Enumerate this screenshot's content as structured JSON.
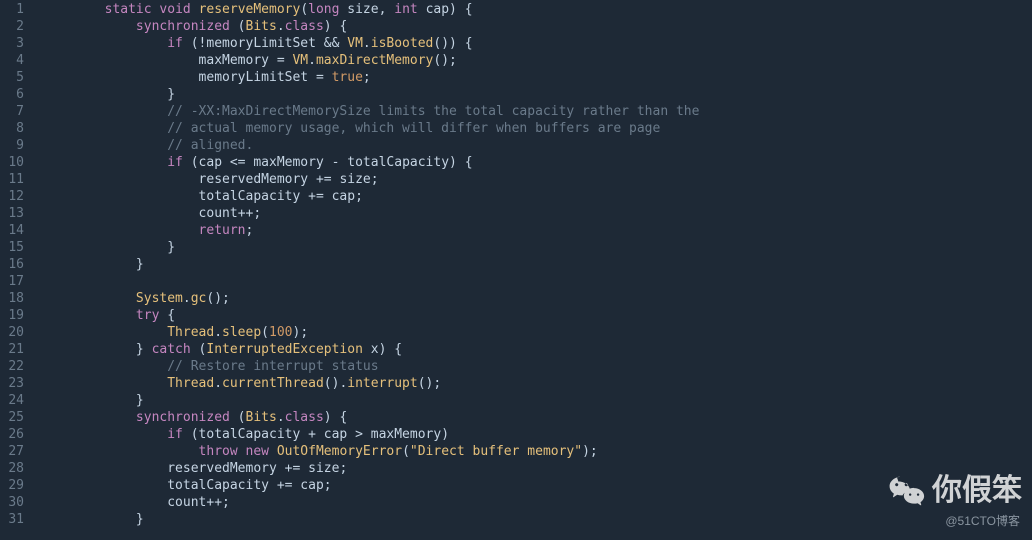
{
  "code": {
    "lines": [
      {
        "num": "1",
        "indent": 2,
        "tokens": [
          [
            "kw",
            "static"
          ],
          [
            "",
            " "
          ],
          [
            "kw",
            "void"
          ],
          [
            "",
            " "
          ],
          [
            "fn",
            "reserveMemory"
          ],
          [
            "pn",
            "("
          ],
          [
            "kw",
            "long"
          ],
          [
            "",
            " "
          ],
          [
            "id",
            "size"
          ],
          [
            "pn",
            ","
          ],
          [
            "",
            " "
          ],
          [
            "kw",
            "int"
          ],
          [
            "",
            " "
          ],
          [
            "id",
            "cap"
          ],
          [
            "pn",
            ")"
          ],
          [
            "",
            " "
          ],
          [
            "pn",
            "{"
          ]
        ]
      },
      {
        "num": "2",
        "indent": 3,
        "tokens": [
          [
            "kw",
            "synchronized"
          ],
          [
            "",
            " "
          ],
          [
            "pn",
            "("
          ],
          [
            "cls",
            "Bits"
          ],
          [
            "pn",
            "."
          ],
          [
            "kw",
            "class"
          ],
          [
            "pn",
            ")"
          ],
          [
            "",
            " "
          ],
          [
            "pn",
            "{"
          ]
        ]
      },
      {
        "num": "3",
        "indent": 4,
        "tokens": [
          [
            "kw",
            "if"
          ],
          [
            "",
            " "
          ],
          [
            "pn",
            "("
          ],
          [
            "op",
            "!"
          ],
          [
            "id",
            "memoryLimitSet"
          ],
          [
            "",
            " "
          ],
          [
            "op",
            "&&"
          ],
          [
            "",
            " "
          ],
          [
            "cls",
            "VM"
          ],
          [
            "pn",
            "."
          ],
          [
            "fn",
            "isBooted"
          ],
          [
            "pn",
            "("
          ],
          [
            "pn",
            ")"
          ],
          [
            "pn",
            ")"
          ],
          [
            "",
            " "
          ],
          [
            "pn",
            "{"
          ]
        ]
      },
      {
        "num": "4",
        "indent": 5,
        "tokens": [
          [
            "id",
            "maxMemory"
          ],
          [
            "",
            " "
          ],
          [
            "op",
            "="
          ],
          [
            "",
            " "
          ],
          [
            "cls",
            "VM"
          ],
          [
            "pn",
            "."
          ],
          [
            "fn",
            "maxDirectMemory"
          ],
          [
            "pn",
            "("
          ],
          [
            "pn",
            ")"
          ],
          [
            "pn",
            ";"
          ]
        ]
      },
      {
        "num": "5",
        "indent": 5,
        "tokens": [
          [
            "id",
            "memoryLimitSet"
          ],
          [
            "",
            " "
          ],
          [
            "op",
            "="
          ],
          [
            "",
            " "
          ],
          [
            "bool",
            "true"
          ],
          [
            "pn",
            ";"
          ]
        ]
      },
      {
        "num": "6",
        "indent": 4,
        "tokens": [
          [
            "pn",
            "}"
          ]
        ]
      },
      {
        "num": "7",
        "indent": 4,
        "tokens": [
          [
            "cmt",
            "// -XX:MaxDirectMemorySize limits the total capacity rather than the"
          ]
        ]
      },
      {
        "num": "8",
        "indent": 4,
        "tokens": [
          [
            "cmt",
            "// actual memory usage, which will differ when buffers are page"
          ]
        ]
      },
      {
        "num": "9",
        "indent": 4,
        "tokens": [
          [
            "cmt",
            "// aligned."
          ]
        ]
      },
      {
        "num": "10",
        "indent": 4,
        "tokens": [
          [
            "kw",
            "if"
          ],
          [
            "",
            " "
          ],
          [
            "pn",
            "("
          ],
          [
            "id",
            "cap"
          ],
          [
            "",
            " "
          ],
          [
            "op",
            "<="
          ],
          [
            "",
            " "
          ],
          [
            "id",
            "maxMemory"
          ],
          [
            "",
            " "
          ],
          [
            "op",
            "-"
          ],
          [
            "",
            " "
          ],
          [
            "id",
            "totalCapacity"
          ],
          [
            "pn",
            ")"
          ],
          [
            "",
            " "
          ],
          [
            "pn",
            "{"
          ]
        ]
      },
      {
        "num": "11",
        "indent": 5,
        "tokens": [
          [
            "id",
            "reservedMemory"
          ],
          [
            "",
            " "
          ],
          [
            "op",
            "+="
          ],
          [
            "",
            " "
          ],
          [
            "id",
            "size"
          ],
          [
            "pn",
            ";"
          ]
        ]
      },
      {
        "num": "12",
        "indent": 5,
        "tokens": [
          [
            "id",
            "totalCapacity"
          ],
          [
            "",
            " "
          ],
          [
            "op",
            "+="
          ],
          [
            "",
            " "
          ],
          [
            "id",
            "cap"
          ],
          [
            "pn",
            ";"
          ]
        ]
      },
      {
        "num": "13",
        "indent": 5,
        "tokens": [
          [
            "id",
            "count"
          ],
          [
            "op",
            "++"
          ],
          [
            "pn",
            ";"
          ]
        ]
      },
      {
        "num": "14",
        "indent": 5,
        "tokens": [
          [
            "kw",
            "return"
          ],
          [
            "pn",
            ";"
          ]
        ]
      },
      {
        "num": "15",
        "indent": 4,
        "tokens": [
          [
            "pn",
            "}"
          ]
        ]
      },
      {
        "num": "16",
        "indent": 3,
        "tokens": [
          [
            "pn",
            "}"
          ]
        ]
      },
      {
        "num": "17",
        "indent": 3,
        "tokens": []
      },
      {
        "num": "18",
        "indent": 3,
        "tokens": [
          [
            "cls",
            "System"
          ],
          [
            "pn",
            "."
          ],
          [
            "fn",
            "gc"
          ],
          [
            "pn",
            "("
          ],
          [
            "pn",
            ")"
          ],
          [
            "pn",
            ";"
          ]
        ]
      },
      {
        "num": "19",
        "indent": 3,
        "tokens": [
          [
            "kw",
            "try"
          ],
          [
            "",
            " "
          ],
          [
            "pn",
            "{"
          ]
        ]
      },
      {
        "num": "20",
        "indent": 4,
        "tokens": [
          [
            "cls",
            "Thread"
          ],
          [
            "pn",
            "."
          ],
          [
            "fn",
            "sleep"
          ],
          [
            "pn",
            "("
          ],
          [
            "num",
            "100"
          ],
          [
            "pn",
            ")"
          ],
          [
            "pn",
            ";"
          ]
        ]
      },
      {
        "num": "21",
        "indent": 3,
        "tokens": [
          [
            "pn",
            "}"
          ],
          [
            "",
            " "
          ],
          [
            "kw",
            "catch"
          ],
          [
            "",
            " "
          ],
          [
            "pn",
            "("
          ],
          [
            "cls",
            "InterruptedException"
          ],
          [
            "",
            " "
          ],
          [
            "id",
            "x"
          ],
          [
            "pn",
            ")"
          ],
          [
            "",
            " "
          ],
          [
            "pn",
            "{"
          ]
        ]
      },
      {
        "num": "22",
        "indent": 4,
        "tokens": [
          [
            "cmt",
            "// Restore interrupt status"
          ]
        ]
      },
      {
        "num": "23",
        "indent": 4,
        "tokens": [
          [
            "cls",
            "Thread"
          ],
          [
            "pn",
            "."
          ],
          [
            "fn",
            "currentThread"
          ],
          [
            "pn",
            "("
          ],
          [
            "pn",
            ")"
          ],
          [
            "pn",
            "."
          ],
          [
            "fn",
            "interrupt"
          ],
          [
            "pn",
            "("
          ],
          [
            "pn",
            ")"
          ],
          [
            "pn",
            ";"
          ]
        ]
      },
      {
        "num": "24",
        "indent": 3,
        "tokens": [
          [
            "pn",
            "}"
          ]
        ]
      },
      {
        "num": "25",
        "indent": 3,
        "tokens": [
          [
            "kw",
            "synchronized"
          ],
          [
            "",
            " "
          ],
          [
            "pn",
            "("
          ],
          [
            "cls",
            "Bits"
          ],
          [
            "pn",
            "."
          ],
          [
            "kw",
            "class"
          ],
          [
            "pn",
            ")"
          ],
          [
            "",
            " "
          ],
          [
            "pn",
            "{"
          ]
        ]
      },
      {
        "num": "26",
        "indent": 4,
        "tokens": [
          [
            "kw",
            "if"
          ],
          [
            "",
            " "
          ],
          [
            "pn",
            "("
          ],
          [
            "id",
            "totalCapacity"
          ],
          [
            "",
            " "
          ],
          [
            "op",
            "+"
          ],
          [
            "",
            " "
          ],
          [
            "id",
            "cap"
          ],
          [
            "",
            " "
          ],
          [
            "op",
            ">"
          ],
          [
            "",
            " "
          ],
          [
            "id",
            "maxMemory"
          ],
          [
            "pn",
            ")"
          ]
        ]
      },
      {
        "num": "27",
        "indent": 5,
        "tokens": [
          [
            "kw",
            "throw"
          ],
          [
            "",
            " "
          ],
          [
            "kw",
            "new"
          ],
          [
            "",
            " "
          ],
          [
            "cls",
            "OutOfMemoryError"
          ],
          [
            "pn",
            "("
          ],
          [
            "str",
            "\"Direct buffer memory\""
          ],
          [
            "pn",
            ")"
          ],
          [
            "pn",
            ";"
          ]
        ]
      },
      {
        "num": "28",
        "indent": 4,
        "tokens": [
          [
            "id",
            "reservedMemory"
          ],
          [
            "",
            " "
          ],
          [
            "op",
            "+="
          ],
          [
            "",
            " "
          ],
          [
            "id",
            "size"
          ],
          [
            "pn",
            ";"
          ]
        ]
      },
      {
        "num": "29",
        "indent": 4,
        "tokens": [
          [
            "id",
            "totalCapacity"
          ],
          [
            "",
            " "
          ],
          [
            "op",
            "+="
          ],
          [
            "",
            " "
          ],
          [
            "id",
            "cap"
          ],
          [
            "pn",
            ";"
          ]
        ]
      },
      {
        "num": "30",
        "indent": 4,
        "tokens": [
          [
            "id",
            "count"
          ],
          [
            "op",
            "++"
          ],
          [
            "pn",
            ";"
          ]
        ]
      },
      {
        "num": "31",
        "indent": 3,
        "tokens": [
          [
            "pn",
            "}"
          ]
        ]
      }
    ]
  },
  "watermark": {
    "text": "你假笨"
  },
  "attribution": {
    "text": "@51CTO博客"
  }
}
